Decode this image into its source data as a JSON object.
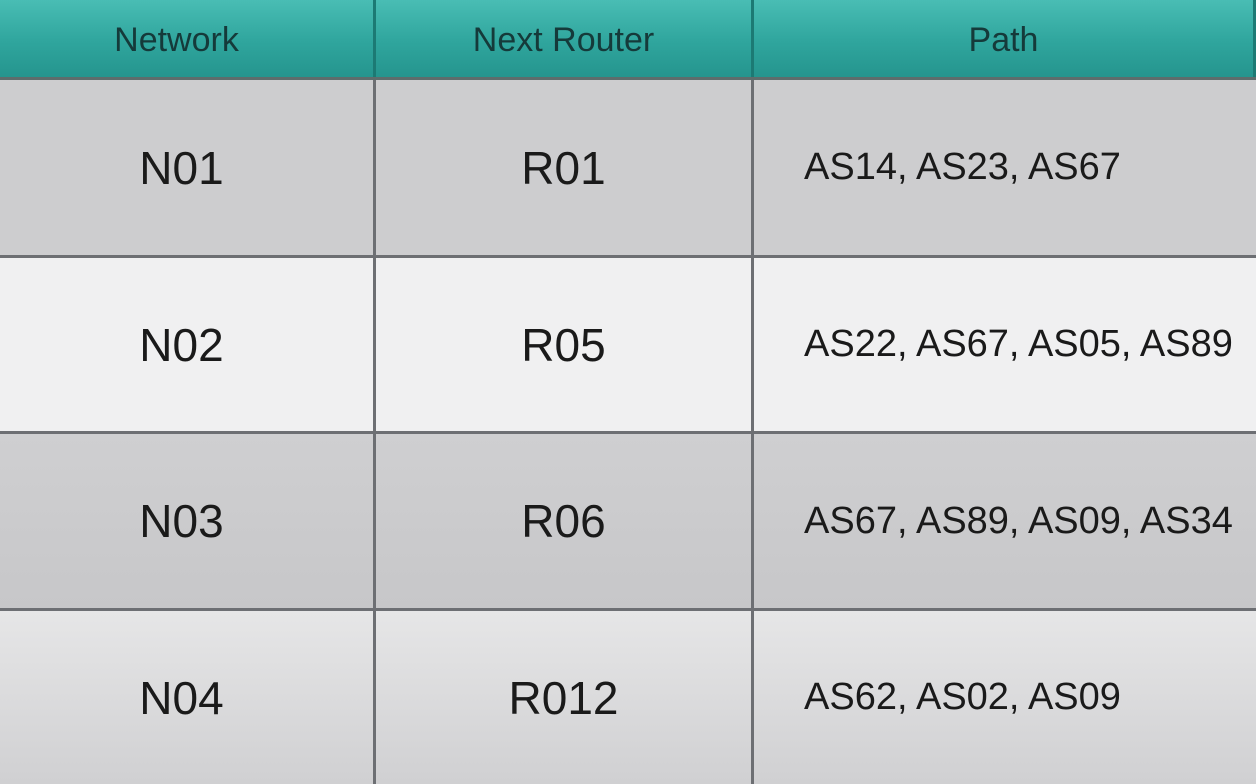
{
  "table": {
    "headers": [
      "Network",
      "Next Router",
      "Path"
    ],
    "rows": [
      {
        "network": "N01",
        "next_router": "R01",
        "path": "AS14, AS23, AS67"
      },
      {
        "network": "N02",
        "next_router": "R05",
        "path": "AS22, AS67, AS05, AS89"
      },
      {
        "network": "N03",
        "next_router": "R06",
        "path": "AS67, AS89, AS09, AS34"
      },
      {
        "network": "N04",
        "next_router": "R012",
        "path": "AS62, AS02, AS09"
      }
    ]
  },
  "colors": {
    "header_background": "#2fa59d",
    "row_light": "#f0f0f1",
    "row_dark": "#cdcdcf",
    "grid_line": "#6d6f73"
  }
}
